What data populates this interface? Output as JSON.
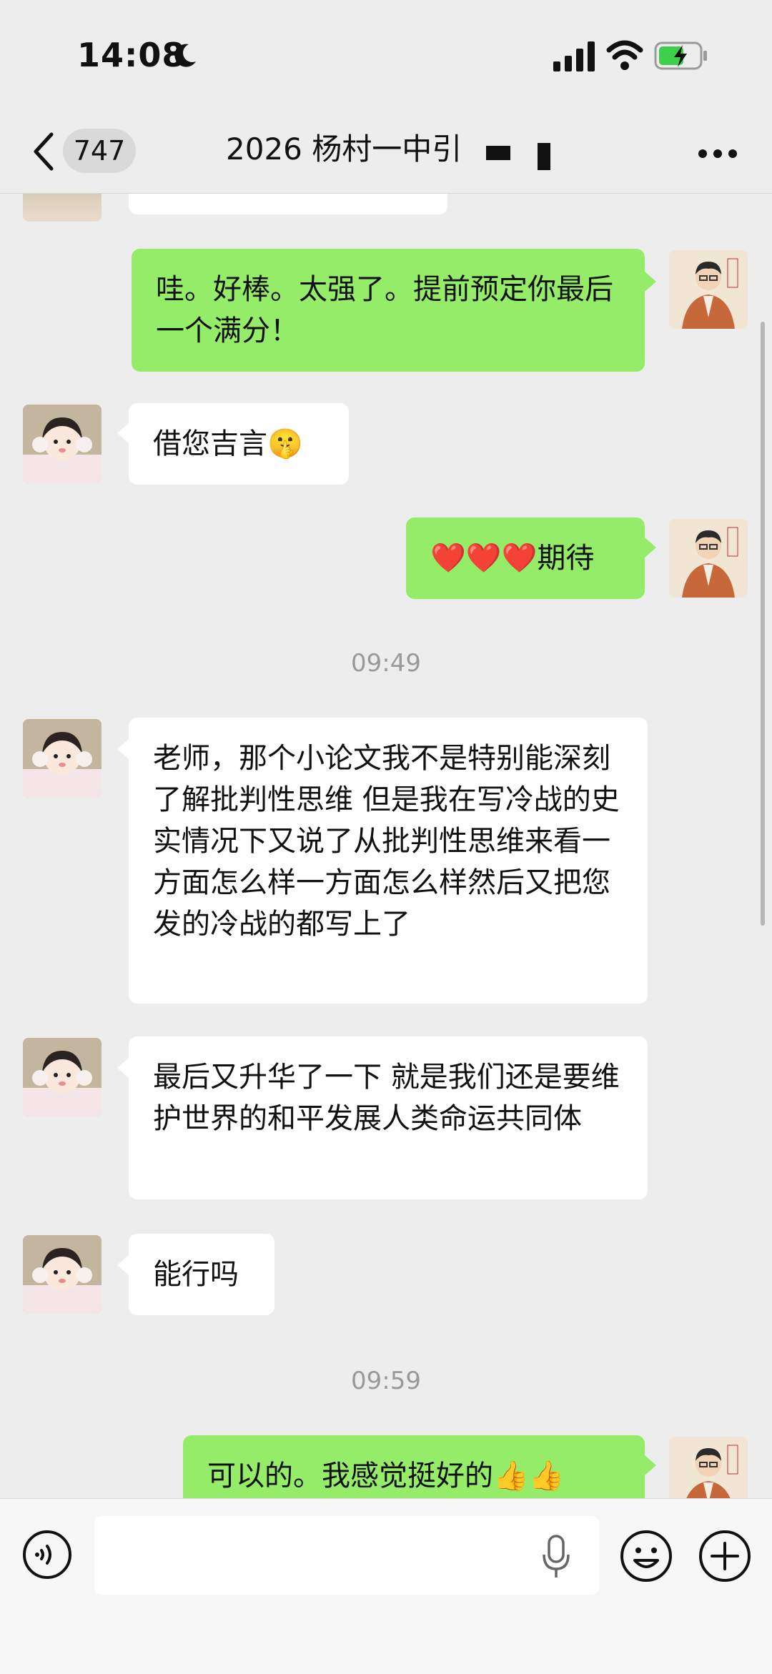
{
  "status": {
    "time": "14:08"
  },
  "nav": {
    "back_count": "747",
    "title": "2026 杨村一中引"
  },
  "messages": [
    {
      "side": "right",
      "text": "哇。好棒。太强了。提前预定你最后一个满分！"
    },
    {
      "side": "left",
      "text": "借您吉言🤫"
    },
    {
      "side": "right",
      "text": "❤️❤️❤️期待"
    },
    {
      "side": "left",
      "text": "老师，那个小论文我不是特别能深刻了解批判性思维 但是我在写冷战的史实情况下又说了从批判性思维来看一方面怎么样一方面怎么样然后又把您发的冷战的都写上了"
    },
    {
      "side": "left",
      "text": "最后又升华了一下 就是我们还是要维护世界的和平发展人类命运共同体"
    },
    {
      "side": "left",
      "text": "能行吗"
    },
    {
      "side": "right",
      "text": "可以的。我感觉挺好的👍👍"
    }
  ],
  "timestamps": [
    "09:49",
    "09:59"
  ],
  "input": {
    "value": ""
  },
  "colors": {
    "accent_green": "#95ec69",
    "background": "#ededed",
    "battery_green": "#3fd04b"
  }
}
